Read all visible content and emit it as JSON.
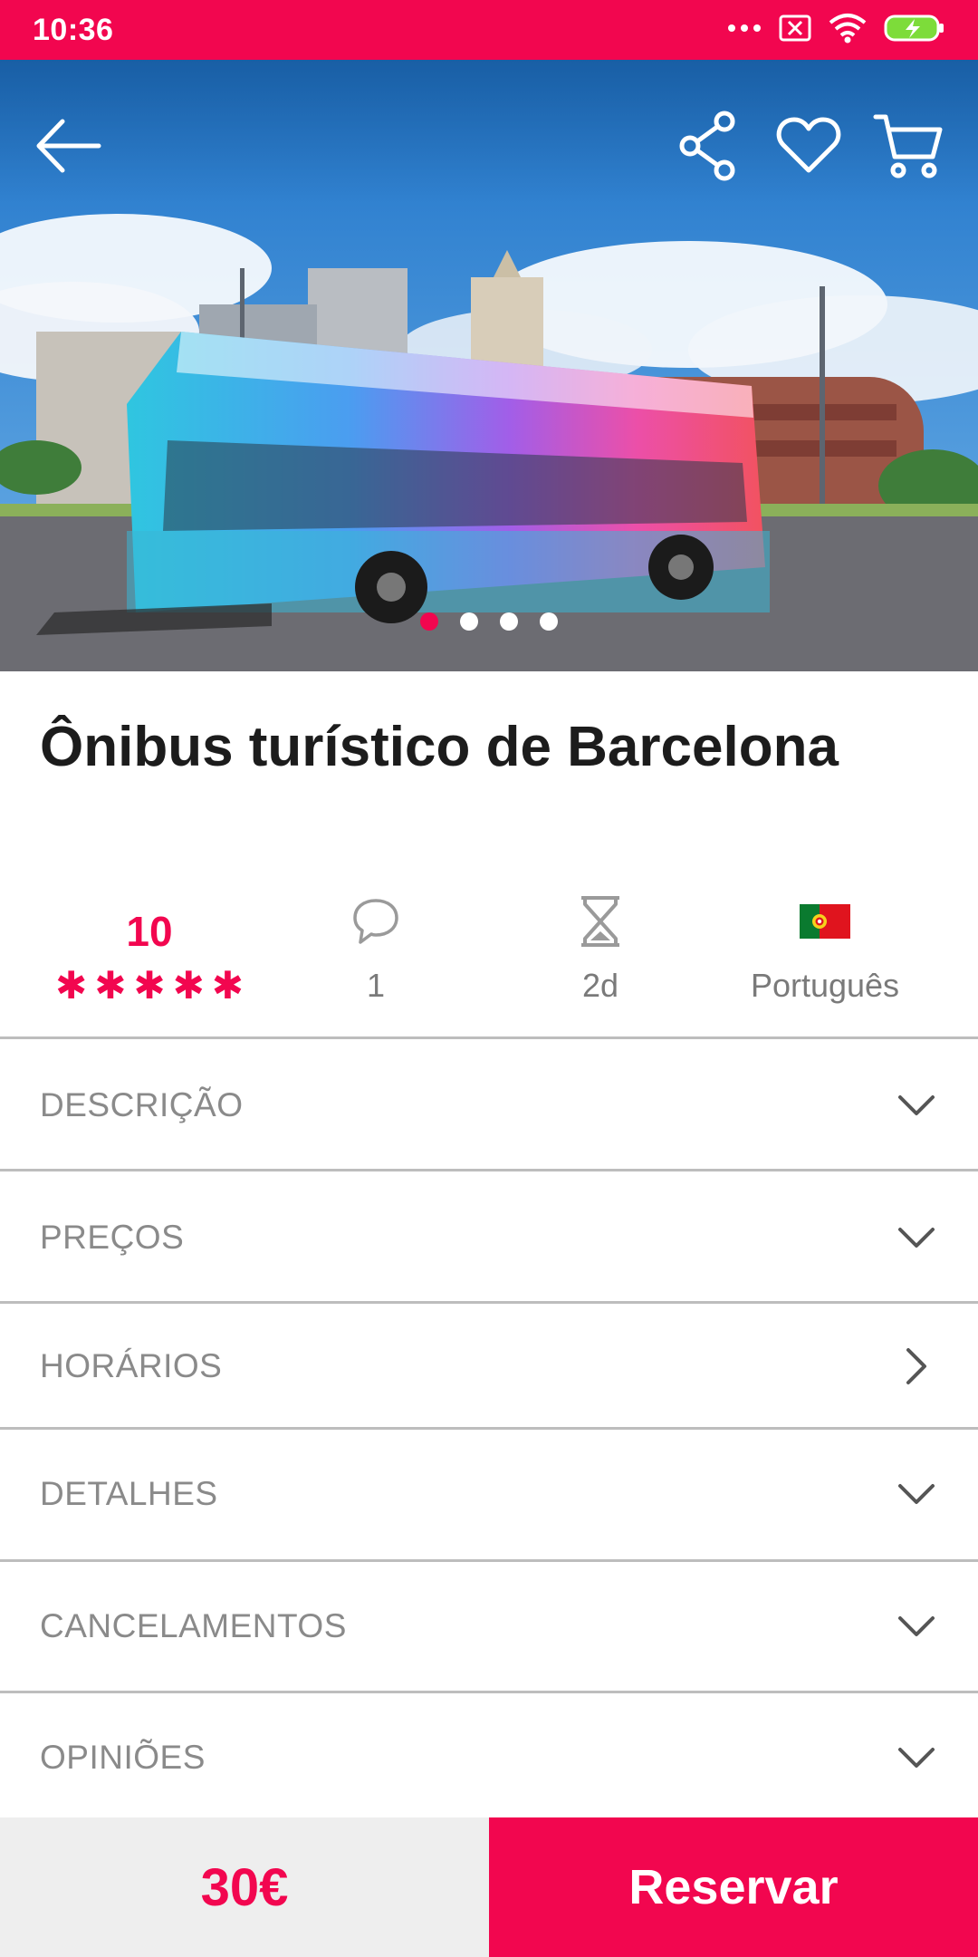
{
  "status_bar": {
    "time": "10:36",
    "icons": [
      "more-dots-icon",
      "notification-x-icon",
      "wifi-icon",
      "battery-charging-icon"
    ]
  },
  "hero": {
    "image": "barcelona-tour-bus-photo",
    "carousel": {
      "count": 4,
      "active_index": 0
    },
    "actions": [
      "back-arrow-icon",
      "share-icon",
      "heart-icon",
      "cart-icon"
    ]
  },
  "title": "Ônibus turístico de Barcelona",
  "stats": {
    "rating": "10",
    "stars": 5,
    "comments": "1",
    "duration": "2d",
    "language": "Português"
  },
  "sections": [
    {
      "label": "DESCRIÇÃO",
      "icon": "chevron-down-icon"
    },
    {
      "label": "PREÇOS",
      "icon": "chevron-down-icon"
    },
    {
      "label": "HORÁRIOS",
      "icon": "chevron-right-icon"
    },
    {
      "label": "DETALHES",
      "icon": "chevron-down-icon"
    },
    {
      "label": "CANCELAMENTOS",
      "icon": "chevron-down-icon"
    },
    {
      "label": "OPINIÕES",
      "icon": "chevron-down-icon"
    }
  ],
  "bottom": {
    "price": "30€",
    "reserve_label": "Reservar"
  },
  "colors": {
    "accent": "#f2064f",
    "muted_text": "#8a8a8a",
    "price_bg": "#eeeeee"
  }
}
